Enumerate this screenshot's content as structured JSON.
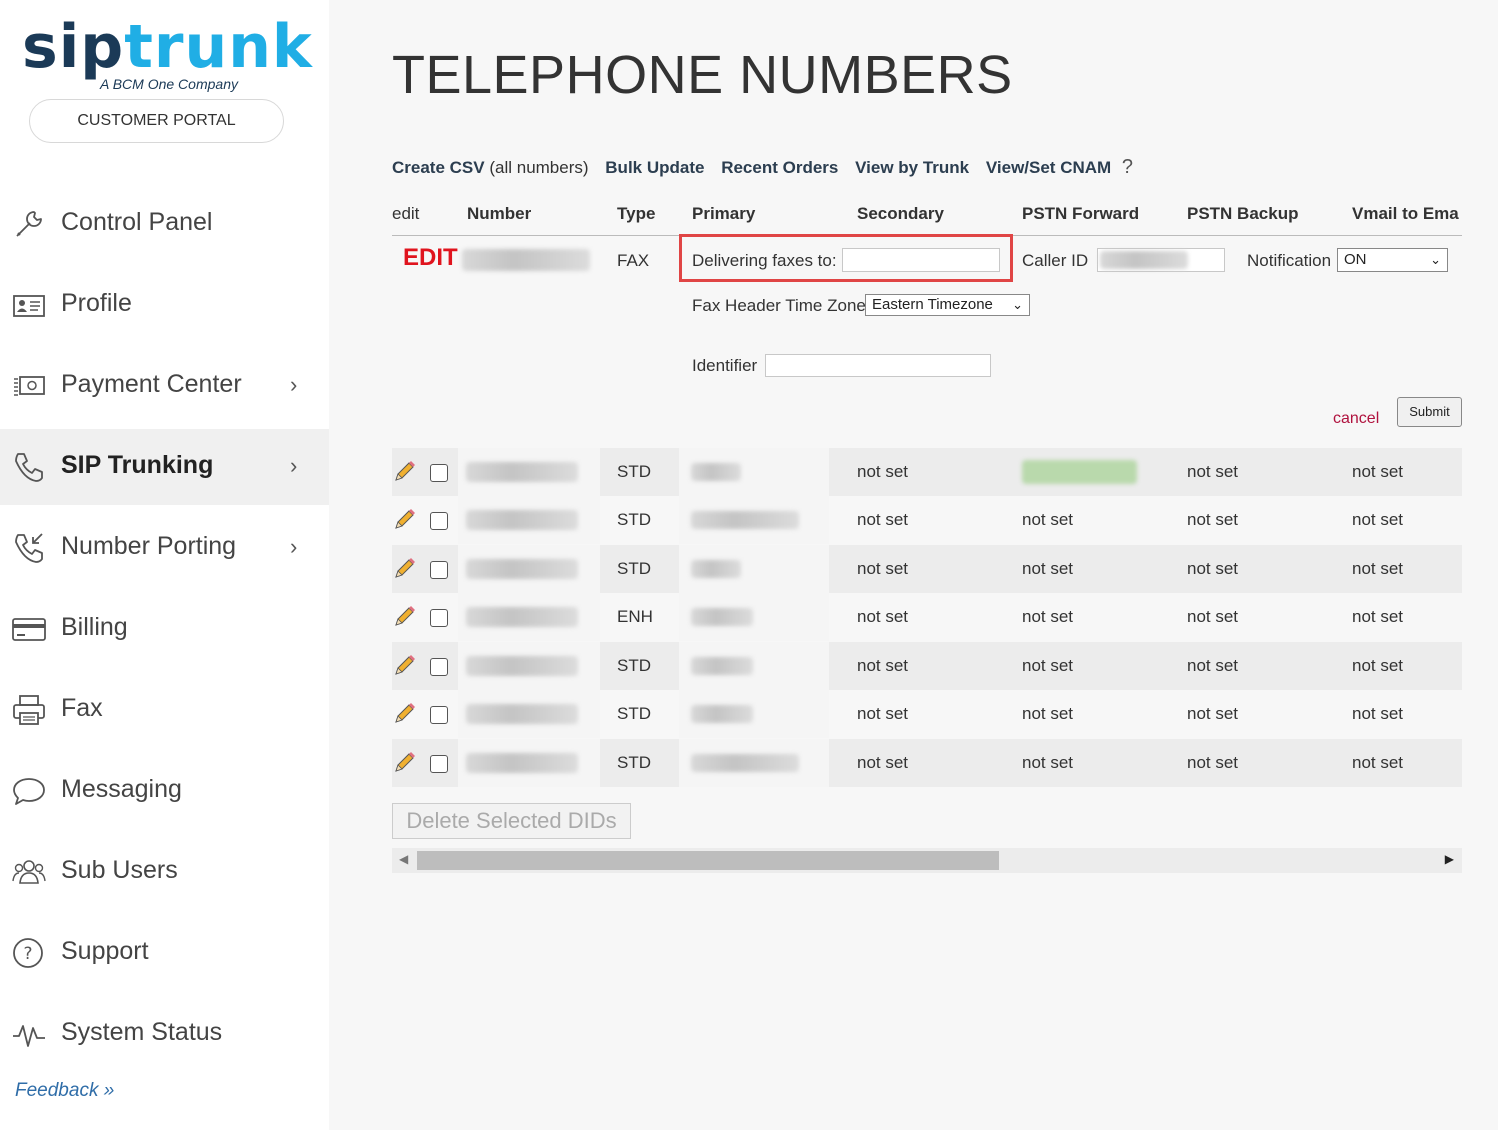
{
  "brand": {
    "logo_sip": "sip",
    "logo_trunk": "trunk",
    "logo_tm": "™",
    "logo_sub": "A BCM One Company",
    "portal_label": "CUSTOMER PORTAL"
  },
  "sidebar": {
    "items": [
      {
        "label": "Control Panel",
        "icon": "wrench-icon"
      },
      {
        "label": "Profile",
        "icon": "id-card-icon"
      },
      {
        "label": "Payment Center",
        "icon": "money-icon",
        "chevron": "›"
      },
      {
        "label": "SIP Trunking",
        "icon": "phone-icon",
        "chevron": "›",
        "active": true
      },
      {
        "label": "Number Porting",
        "icon": "phone-incoming-icon",
        "chevron": "›"
      },
      {
        "label": "Billing",
        "icon": "credit-card-icon"
      },
      {
        "label": "Fax",
        "icon": "printer-icon"
      },
      {
        "label": "Messaging",
        "icon": "chat-bubble-icon"
      },
      {
        "label": "Sub Users",
        "icon": "users-icon"
      },
      {
        "label": "Support",
        "icon": "question-circle-icon"
      },
      {
        "label": "System Status",
        "icon": "pulse-icon"
      }
    ],
    "feedback": "Feedback »"
  },
  "main": {
    "title": "TELEPHONE NUMBERS",
    "toolbar": {
      "create_csv": "Create CSV",
      "create_csv_note": "(all numbers)",
      "bulk_update": "Bulk Update",
      "recent_orders": "Recent Orders",
      "view_by_trunk": "View by Trunk",
      "view_set_cnam": "View/Set CNAM",
      "help": "?"
    },
    "columns": [
      "edit",
      "Number",
      "Type",
      "Primary",
      "Secondary",
      "PSTN Forward",
      "PSTN Backup",
      "Vmail to Ema"
    ],
    "edit_row": {
      "edit_label": "EDIT",
      "type": "FAX",
      "delivering_label": "Delivering faxes to:",
      "delivering_value": "",
      "caller_id_label": "Caller ID",
      "notification_label": "Notification",
      "notification_value": "ON",
      "tz_label": "Fax Header Time Zone",
      "tz_value": "Eastern Timezone",
      "identifier_label": "Identifier",
      "identifier_value": "",
      "cancel": "cancel",
      "submit": "Submit"
    },
    "rows": [
      {
        "type": "STD",
        "secondary": "not set",
        "pstn_forward": "",
        "pstn_backup": "not set",
        "vmail": "not set"
      },
      {
        "type": "STD",
        "secondary": "not set",
        "pstn_forward": "not set",
        "pstn_backup": "not set",
        "vmail": "not set"
      },
      {
        "type": "STD",
        "secondary": "not set",
        "pstn_forward": "not set",
        "pstn_backup": "not set",
        "vmail": "not set"
      },
      {
        "type": "ENH",
        "secondary": "not set",
        "pstn_forward": "not set",
        "pstn_backup": "not set",
        "vmail": "not set"
      },
      {
        "type": "STD",
        "secondary": "not set",
        "pstn_forward": "not set",
        "pstn_backup": "not set",
        "vmail": "not set"
      },
      {
        "type": "STD",
        "secondary": "not set",
        "pstn_forward": "not set",
        "pstn_backup": "not set",
        "vmail": "not set"
      },
      {
        "type": "STD",
        "secondary": "not set",
        "pstn_forward": "not set",
        "pstn_backup": "not set",
        "vmail": "not set"
      }
    ],
    "delete_button": "Delete Selected DIDs"
  },
  "colors": {
    "accent_blue": "#20aee5",
    "brand_navy": "#1b3a57",
    "edit_red": "#e0141e",
    "highlight_box": "#e04545"
  }
}
